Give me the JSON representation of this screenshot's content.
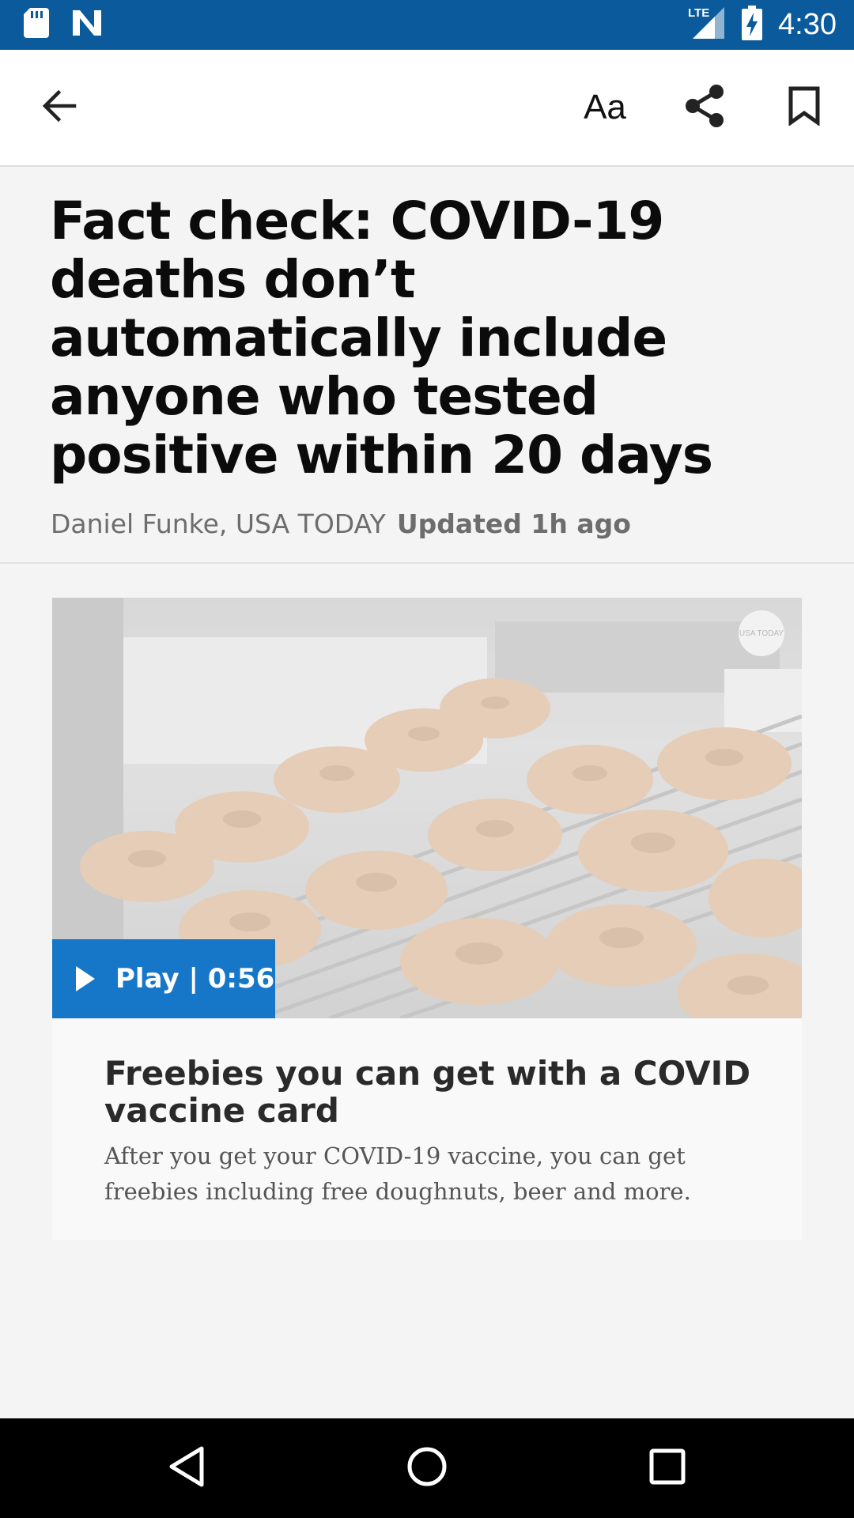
{
  "status_bar": {
    "time": "4:30",
    "network_label": "LTE",
    "icons": [
      "sd-card-icon",
      "n-logo-icon",
      "signal-icon",
      "battery-charging-icon"
    ],
    "background_color": "#0a5a9c"
  },
  "app_bar": {
    "text_size_label": "Aa",
    "icons": [
      "back-arrow-icon",
      "share-icon",
      "bookmark-icon"
    ]
  },
  "article": {
    "headline": "Fact check: COVID-19 deaths don’t automatically include anyone who tested positive within 20 days",
    "author": "Daniel Funke, USA TODAY",
    "updated": "Updated 1h ago"
  },
  "video": {
    "play_label": "Play | 0:56",
    "logo_text": "USA TODAY",
    "title": "Freebies you can get with a COVID vaccine card",
    "description": "After you get your COVID-19 vaccine, you can get freebies including free doughnuts, beer and more.",
    "accent_color": "#1676c8"
  },
  "nav_bar": {
    "icons": [
      "nav-back-icon",
      "nav-home-icon",
      "nav-recents-icon"
    ]
  }
}
